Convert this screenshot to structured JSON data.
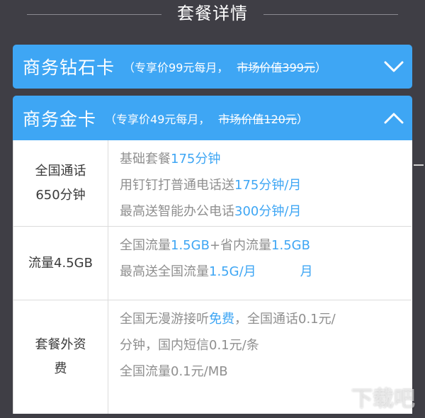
{
  "header": {
    "title": "套餐详情"
  },
  "plans": [
    {
      "name": "商务钻石卡",
      "price": "（专享价99元每月，",
      "market_price": "市场价值399元",
      "close": "）",
      "expanded": false,
      "chevron_icon": "chevron-down-icon"
    },
    {
      "name": "商务金卡",
      "price": "（专享价49元每月，",
      "market_price": "市场价值120元",
      "close": "）",
      "expanded": true,
      "chevron_icon": "chevron-up-icon"
    }
  ],
  "details": {
    "calls": {
      "label_line1": "全国通话",
      "label_line2": "650分钟",
      "l1_text": "基础套餐",
      "l1_hl": "175分钟",
      "l2_text": "用钉钉打普通电话送",
      "l2_hl": "175分钟/月",
      "l3_text": "最高送智能办公电话",
      "l3_hl": "300分钟/月"
    },
    "data": {
      "label": "流量4.5GB",
      "l1_text_a": "全国流量",
      "l1_hl_a": "1.5GB",
      "l1_text_b": "+省内流量",
      "l1_hl_b": "1.5GB",
      "l2_text": "最高送全国流量",
      "l2_hl": "1.5G/月",
      "l2_hl_extra": "月"
    },
    "extra": {
      "label_line1": "套餐外资",
      "label_line2": "费",
      "l1_text_a": "全国无漫游接听",
      "l1_hl": "免费",
      "l1_text_b": "，全国通话0.1元/",
      "l2_text": "分钟，国内短信0.1元/条",
      "l3_text": "全国流量0.1元/MB"
    }
  },
  "colors": {
    "accent": "#3ea6f4",
    "background": "#3f3e45",
    "muted_text": "#8f8f8f"
  },
  "watermark": "下载吧"
}
